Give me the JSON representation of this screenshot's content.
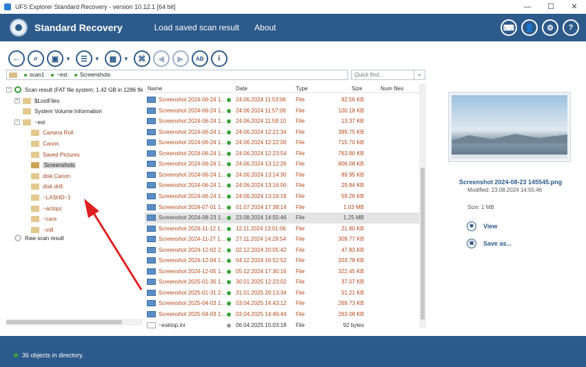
{
  "window": {
    "title": "UFS Explorer Standard Recovery - version 10.12.1 [64 bit]",
    "controls": [
      "—",
      "☐",
      "✕"
    ]
  },
  "header": {
    "brand": "Standard Recovery",
    "nav": [
      "Load saved scan result",
      "About"
    ],
    "buttons": [
      "keyboard-icon",
      "user-icon",
      "gear-icon",
      "help-icon"
    ]
  },
  "toolbar": {
    "items": [
      "back-icon",
      "search-icon",
      "save-icon",
      "list-icon",
      "select-icon",
      "binoculars-icon",
      "prev-icon",
      "next-icon",
      "text-icon",
      "info-icon"
    ],
    "ab_label": "AB",
    "info_label": "i"
  },
  "path": {
    "crumbs": [
      "scan1",
      "~est",
      "Screenshots"
    ],
    "quick_find_placeholder": "Quick find..."
  },
  "tree": {
    "root": "Scan result (FAT file system; 1.42 GB in 1286 files)",
    "items": [
      {
        "label": "$LostFiles",
        "level": 1,
        "expander": "+"
      },
      {
        "label": "System Volume Information",
        "level": 1,
        "expander": ""
      },
      {
        "label": "~est",
        "level": 1,
        "expander": "−"
      },
      {
        "label": "Camera Roll",
        "level": 2,
        "red": true
      },
      {
        "label": "Canon",
        "level": 2,
        "red": true
      },
      {
        "label": "Saved Pictures",
        "level": 2,
        "red": true
      },
      {
        "label": "Screenshots",
        "level": 2,
        "selected": true
      },
      {
        "label": "disk Canon",
        "level": 2,
        "red": true
      },
      {
        "label": "disk drill",
        "level": 2,
        "red": true
      },
      {
        "label": "~LASHD~1",
        "level": 2,
        "red": true
      },
      {
        "label": "~actopc",
        "level": 2,
        "red": true
      },
      {
        "label": "~care",
        "level": 2,
        "red": true
      },
      {
        "label": "~in8",
        "level": 2,
        "red": true
      }
    ],
    "raw": "Raw scan result"
  },
  "list": {
    "columns": {
      "name": "Name",
      "date": "Date",
      "type": "Type",
      "size": "Size",
      "num_files": "Num files"
    },
    "rows": [
      {
        "name": "Screenshot 2024-06-24 1...",
        "date": "24.06.2024 11:53:06",
        "type": "File",
        "size": "92.56 KB"
      },
      {
        "name": "Screenshot 2024-06-24 1...",
        "date": "24.06.2024 11:57:06",
        "type": "File",
        "size": "100.18 KB"
      },
      {
        "name": "Screenshot 2024-06-24 1...",
        "date": "24.06.2024 11:59:10",
        "type": "File",
        "size": "13.37 KB"
      },
      {
        "name": "Screenshot 2024-06-24 1...",
        "date": "24.06.2024 12:21:34",
        "type": "File",
        "size": "399.75 KB"
      },
      {
        "name": "Screenshot 2024-06-24 1...",
        "date": "24.06.2024 12:22:00",
        "type": "File",
        "size": "715.70 KB"
      },
      {
        "name": "Screenshot 2024-06-24 1...",
        "date": "24.06.2024 12:23:54",
        "type": "File",
        "size": "763.80 KB"
      },
      {
        "name": "Screenshot 2024-06-24 1...",
        "date": "24.06.2024 13:12:26",
        "type": "File",
        "size": "806.08 KB"
      },
      {
        "name": "Screenshot 2024-06-24 1...",
        "date": "24.06.2024 13:14:30",
        "type": "File",
        "size": "89.95 KB"
      },
      {
        "name": "Screenshot 2024-06-24 1...",
        "date": "24.06.2024 13:16:00",
        "type": "File",
        "size": "29.84 KB"
      },
      {
        "name": "Screenshot 2024-06-24 1...",
        "date": "24.06.2024 13:16:18",
        "type": "File",
        "size": "59.26 KB"
      },
      {
        "name": "Screenshot 2024-07-01 1...",
        "date": "01.07.2024 17:38:14",
        "type": "File",
        "size": "1.03 MB"
      },
      {
        "name": "Screenshot 2024-08-23 1...",
        "date": "23.08.2024 14:55:46",
        "type": "File",
        "size": "1.25 MB",
        "selected": true
      },
      {
        "name": "Screenshot 2024-11-12 1...",
        "date": "12.11.2024 13:01:06",
        "type": "File",
        "size": "21.80 KB"
      },
      {
        "name": "Screenshot 2024-11-27 1...",
        "date": "27.11.2024 14:29:54",
        "type": "File",
        "size": "309.77 KB"
      },
      {
        "name": "Screenshot 2024-12-02 2...",
        "date": "02.12.2024 20:05:42",
        "type": "File",
        "size": "47.83 KB"
      },
      {
        "name": "Screenshot 2024-12-04 1...",
        "date": "04.12.2024 16:52:52",
        "type": "File",
        "size": "203.78 KB"
      },
      {
        "name": "Screenshot 2024-12-05 1...",
        "date": "05.12.2024 17:30:16",
        "type": "File",
        "size": "322.45 KB"
      },
      {
        "name": "Screenshot 2025-01-30 1...",
        "date": "30.01.2025 12:23:02",
        "type": "File",
        "size": "37.07 KB"
      },
      {
        "name": "Screenshot 2025-01-31 2...",
        "date": "31.01.2025 20:13:34",
        "type": "File",
        "size": "51.21 KB"
      },
      {
        "name": "Screenshot 2025-04-03 1...",
        "date": "03.04.2025 14:43:12",
        "type": "File",
        "size": "269.73 KB"
      },
      {
        "name": "Screenshot 2025-04-03 1...",
        "date": "03.04.2025 14:46:44",
        "type": "File",
        "size": "263.08 KB"
      },
      {
        "name": "~esktop.ini",
        "date": "06.04.2025 15:03:18",
        "type": "File",
        "size": "92 bytes",
        "ini": true
      }
    ]
  },
  "preview": {
    "name": "Screenshot 2024-08-23 145545.png",
    "modified": "Modified: 23.08.2024 14:55:46",
    "size": "Size: 1 MB",
    "actions": [
      {
        "label": "View",
        "icon": "eye-icon"
      },
      {
        "label": "Save as...",
        "icon": "save-icon"
      }
    ]
  },
  "status": {
    "text": "36 objects in directory."
  },
  "colors": {
    "accent": "#2c5a8a",
    "file_text": "#b5471c",
    "ok": "#3aa33a",
    "annotation": "#e02020"
  }
}
